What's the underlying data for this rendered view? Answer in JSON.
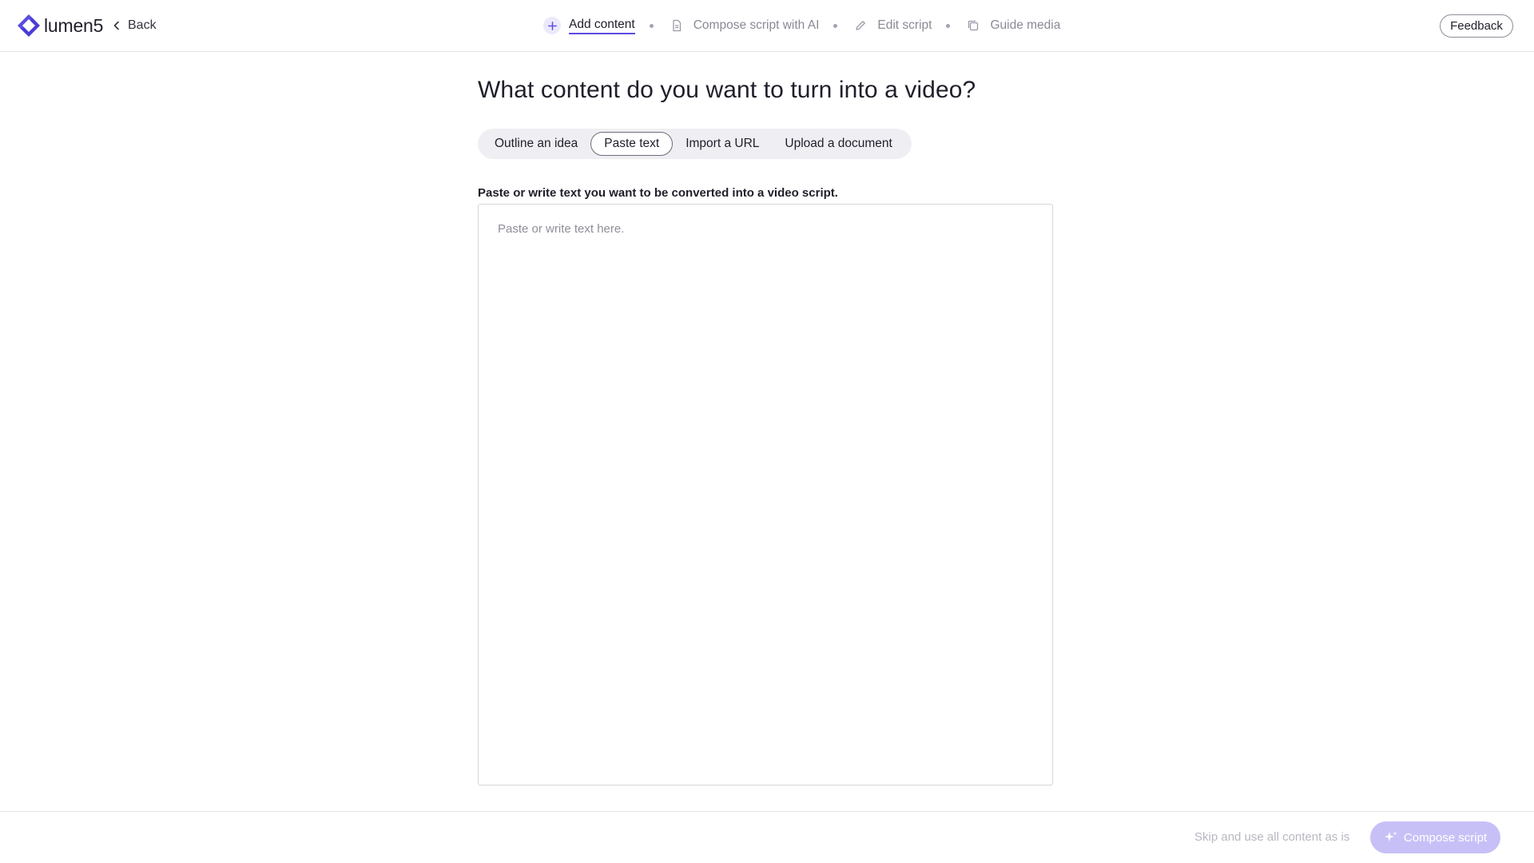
{
  "app": {
    "logo_text": "lumen5",
    "back_label": "Back",
    "feedback_label": "Feedback",
    "accent_color": "#5b4ce0"
  },
  "steps": [
    {
      "label": "Add content",
      "icon": "plus-icon",
      "active": true
    },
    {
      "label": "Compose script with AI",
      "icon": "document-icon",
      "active": false
    },
    {
      "label": "Edit script",
      "icon": "pencil-icon",
      "active": false
    },
    {
      "label": "Guide media",
      "icon": "media-stack-icon",
      "active": false
    }
  ],
  "main": {
    "title": "What content do you want to turn into a video?",
    "tabs": [
      {
        "label": "Outline an idea",
        "selected": false
      },
      {
        "label": "Paste text",
        "selected": true
      },
      {
        "label": "Import a URL",
        "selected": false
      },
      {
        "label": "Upload a document",
        "selected": false
      }
    ],
    "field_label": "Paste or write text you want to be converted into a video script.",
    "textarea": {
      "value": "",
      "placeholder": "Paste or write text here."
    }
  },
  "footer": {
    "skip_label": "Skip and use all content as is",
    "compose_label": "Compose script",
    "compose_enabled": false
  }
}
